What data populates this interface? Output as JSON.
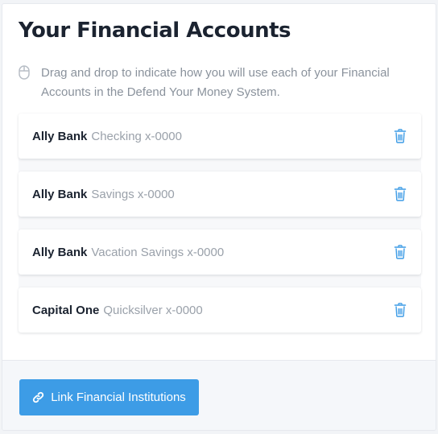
{
  "panel": {
    "title": "Your Financial Accounts",
    "instructions": "Drag and drop to indicate how you will use each of your Financial Accounts in the Defend Your Money System.",
    "instructions_icon": "mouse-icon"
  },
  "accounts": [
    {
      "bank": "Ally Bank",
      "detail": "Checking x-0000",
      "action_icon": "trash-icon"
    },
    {
      "bank": "Ally Bank",
      "detail": "Savings x-0000",
      "action_icon": "trash-icon"
    },
    {
      "bank": "Ally Bank",
      "detail": "Vacation Savings x-0000",
      "action_icon": "trash-icon"
    },
    {
      "bank": "Capital One",
      "detail": "Quicksilver x-0000",
      "action_icon": "trash-icon"
    }
  ],
  "footer": {
    "link_button_label": "Link Financial Institutions",
    "link_button_icon": "link-icon"
  },
  "colors": {
    "accent": "#3d9ce6",
    "trash_icon": "#3d9ce6",
    "title_text": "#1b2330",
    "muted_text": "#8a929c"
  }
}
